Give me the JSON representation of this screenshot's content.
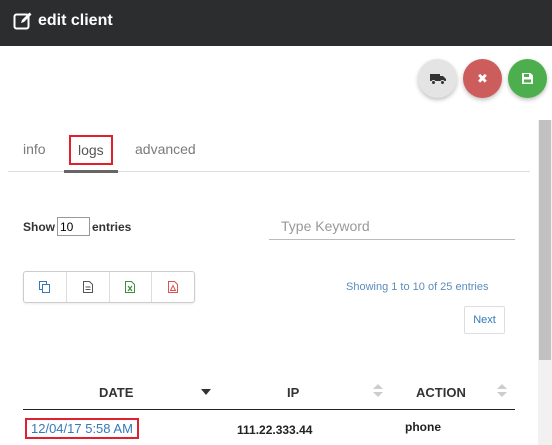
{
  "header": {
    "title": "edit client",
    "icon": "edit-icon",
    "background": "#2b2d2f"
  },
  "actions": {
    "truck": {
      "icon": "truck-icon",
      "color": "#e4e4e4"
    },
    "cancel": {
      "icon": "close-icon",
      "glyph": "✖",
      "color": "#cd5c5c"
    },
    "save": {
      "icon": "floppy-icon",
      "color": "#4cae4c"
    }
  },
  "tabs": [
    {
      "label": "info"
    },
    {
      "label": "logs",
      "active": true
    },
    {
      "label": "advanced"
    }
  ],
  "length_menu": {
    "prefix": "Show",
    "value": "10",
    "suffix": "entries"
  },
  "search": {
    "placeholder": "Type Keyword"
  },
  "export_buttons": [
    {
      "icon": "copy-icon",
      "color": "#337ab7"
    },
    {
      "icon": "document-icon",
      "color": "#555555"
    },
    {
      "icon": "excel-icon",
      "color": "#3c8d3c"
    },
    {
      "icon": "pdf-icon",
      "color": "#d9534f"
    }
  ],
  "table_info": "Showing 1 to 10 of 25 entries",
  "pagination": {
    "next_label": "Next"
  },
  "table": {
    "columns": [
      "DATE",
      "IP",
      "ACTION"
    ],
    "rows": [
      {
        "date": "12/04/17 5:58 AM",
        "ip": "111.22.333.44",
        "action": "phone"
      }
    ]
  }
}
